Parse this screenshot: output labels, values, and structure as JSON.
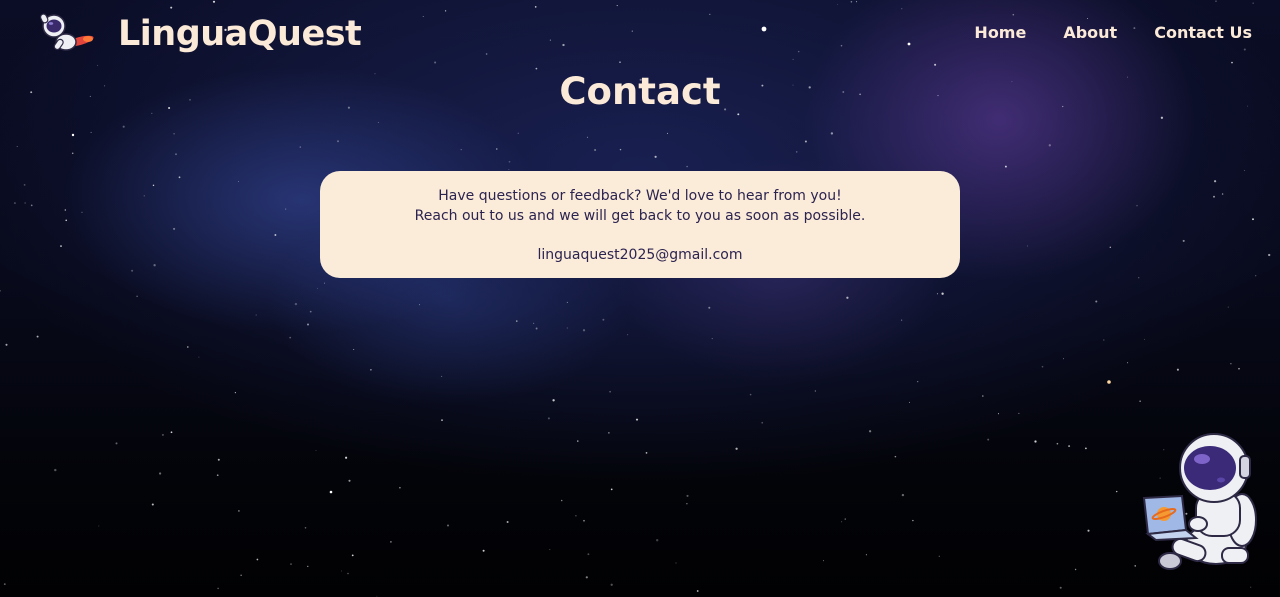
{
  "brand": {
    "name": "LinguaQuest",
    "logo_icon": "astronaut-rocket-icon"
  },
  "nav": {
    "items": [
      "Home",
      "About",
      "Contact Us"
    ]
  },
  "page": {
    "title": "Contact",
    "card": {
      "line1": "Have questions or feedback? We'd love to hear from you!",
      "line2": "Reach out to us and we will get back to you as soon as possible.",
      "email": "linguaquest2025@gmail.com"
    }
  },
  "mascot": {
    "icon": "astronaut-laptop-icon"
  },
  "colors": {
    "text_cream": "#fbead7",
    "card_bg": "#fbebd9",
    "card_text": "#2c2450",
    "space_dark": "#080a1c"
  }
}
